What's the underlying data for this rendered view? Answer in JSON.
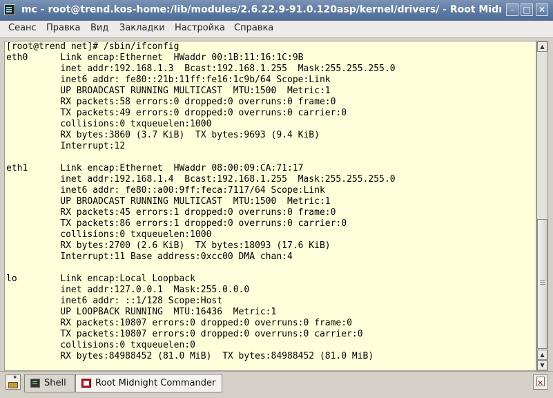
{
  "window": {
    "title": "mc - root@trend.kos-home:/lib/modules/2.6.22.9-91.0.120asp/kernel/drivers/ - Root Midnight Commander",
    "buttons": {
      "minimize": "–",
      "maximize": "□",
      "close": "✕"
    }
  },
  "menu": [
    "Сеанс",
    "Правка",
    "Вид",
    "Закладки",
    "Настройка",
    "Справка"
  ],
  "terminal": {
    "lines": [
      "[root@trend net]# /sbin/ifconfig",
      "eth0      Link encap:Ethernet  HWaddr 00:1B:11:16:1C:9B",
      "          inet addr:192.168.1.3  Bcast:192.168.1.255  Mask:255.255.255.0",
      "          inet6 addr: fe80::21b:11ff:fe16:1c9b/64 Scope:Link",
      "          UP BROADCAST RUNNING MULTICAST  MTU:1500  Metric:1",
      "          RX packets:58 errors:0 dropped:0 overruns:0 frame:0",
      "          TX packets:49 errors:0 dropped:0 overruns:0 carrier:0",
      "          collisions:0 txqueuelen:1000",
      "          RX bytes:3860 (3.7 KiB)  TX bytes:9693 (9.4 KiB)",
      "          Interrupt:12",
      "",
      "eth1      Link encap:Ethernet  HWaddr 08:00:09:CA:71:17",
      "          inet addr:192.168.1.4  Bcast:192.168.1.255  Mask:255.255.255.0",
      "          inet6 addr: fe80::a00:9ff:feca:7117/64 Scope:Link",
      "          UP BROADCAST RUNNING MULTICAST  MTU:1500  Metric:1",
      "          RX packets:45 errors:1 dropped:0 overruns:0 frame:0",
      "          TX packets:86 errors:1 dropped:0 overruns:0 carrier:0",
      "          collisions:0 txqueuelen:1000",
      "          RX bytes:2700 (2.6 KiB)  TX bytes:18093 (17.6 KiB)",
      "          Interrupt:11 Base address:0xcc00 DMA chan:4",
      "",
      "lo        Link encap:Local Loopback",
      "          inet addr:127.0.0.1  Mask:255.0.0.0",
      "          inet6 addr: ::1/128 Scope:Host",
      "          UP LOOPBACK RUNNING  MTU:16436  Metric:1",
      "          RX packets:10807 errors:0 dropped:0 overruns:0 frame:0",
      "          TX packets:10807 errors:0 dropped:0 overruns:0 carrier:0",
      "          collisions:0 txqueuelen:0",
      "          RX bytes:84988452 (81.0 MiB)  TX bytes:84988452 (81.0 MiB)"
    ],
    "background": "#fefeda"
  },
  "tabs": [
    {
      "label": "Shell",
      "active": false,
      "icon": "terminal-icon"
    },
    {
      "label": "Root Midnight Commander",
      "active": true,
      "icon": "mc-icon"
    }
  ]
}
